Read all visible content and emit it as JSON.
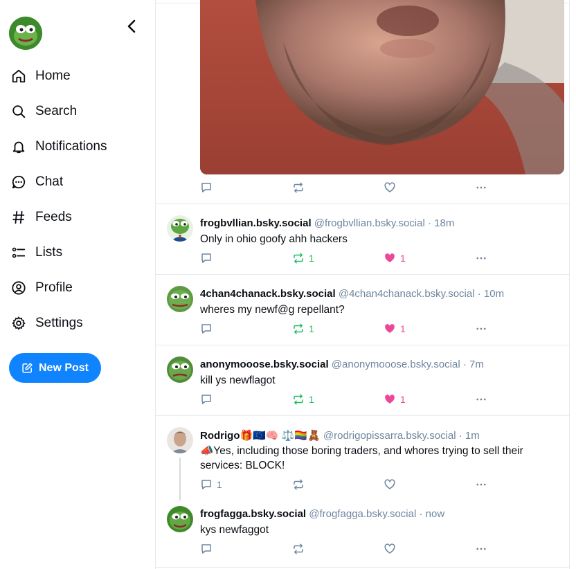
{
  "sidebar": {
    "nav": [
      {
        "label": "Home",
        "icon": "home-icon"
      },
      {
        "label": "Search",
        "icon": "search-icon"
      },
      {
        "label": "Notifications",
        "icon": "bell-icon"
      },
      {
        "label": "Chat",
        "icon": "chat-icon"
      },
      {
        "label": "Feeds",
        "icon": "hash-icon"
      },
      {
        "label": "Lists",
        "icon": "list-icon"
      },
      {
        "label": "Profile",
        "icon": "profile-icon"
      },
      {
        "label": "Settings",
        "icon": "gear-icon"
      }
    ],
    "new_post_label": "New Post"
  },
  "colors": {
    "accent": "#1083fe",
    "repost_active": "#20bc62",
    "like_active": "#ec4899",
    "muted": "#6f869f"
  },
  "posts": [
    {
      "name": "frogbvllian.bsky.social",
      "handle": "@frogbvllian.bsky.social",
      "time": "· 18m",
      "text": "Only in ohio goofy ahh hackers",
      "reposts": "1",
      "likes": "1"
    },
    {
      "name": "4chan4chanack.bsky.social",
      "handle": "@4chan4chanack.bsky.social",
      "time": "· 10m",
      "text": "wheres my newf@g repellant?",
      "reposts": "1",
      "likes": "1"
    },
    {
      "name": "anonymooose.bsky.social",
      "handle": "@anonymooose.bsky.social",
      "time": "· 7m",
      "text": "kill ys newflagot",
      "reposts": "1",
      "likes": "1"
    },
    {
      "name": "Rodrigo🎁🇪🇺🧠 ⚖️🏳️‍🌈🧸",
      "handle": "@rodrigopissarra.bsky.social",
      "time": "· 1m",
      "text": "📣Yes, including those boring traders, and whores trying to sell their services: BLOCK!",
      "replies": "1"
    },
    {
      "name": "frogfagga.bsky.social",
      "handle": "@frogfagga.bsky.social",
      "time": "· now",
      "text": "kys newfaggot"
    }
  ]
}
